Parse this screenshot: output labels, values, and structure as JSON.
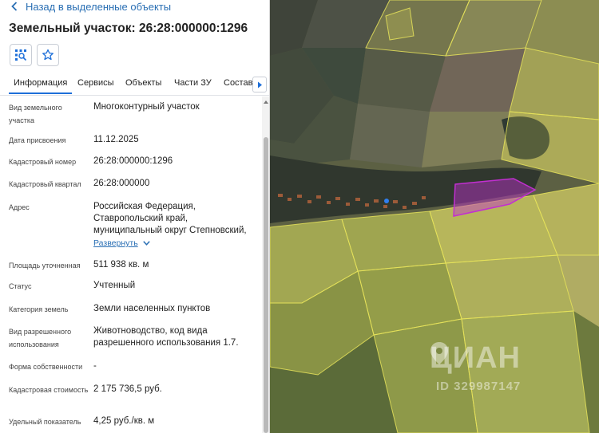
{
  "header": {
    "back_label": "Назад в выделенные объекты",
    "title": "Земельный участок: 26:28:000000:1296"
  },
  "toolbar": {
    "locate_icon": "locate-on-map-icon",
    "favorite_icon": "star-icon"
  },
  "tabs": [
    {
      "label": "Информация",
      "active": true
    },
    {
      "label": "Сервисы",
      "active": false
    },
    {
      "label": "Объекты",
      "active": false
    },
    {
      "label": "Части ЗУ",
      "active": false
    },
    {
      "label": "Состав",
      "active": false
    }
  ],
  "properties": [
    {
      "label": "Вид земельного участка",
      "value": "Многоконтурный участок"
    },
    {
      "label": "Дата присвоения",
      "value": "11.12.2025"
    },
    {
      "label": "Кадастровый номер",
      "value": "26:28:000000:1296"
    },
    {
      "label": "Кадастровый квартал",
      "value": "26:28:000000"
    },
    {
      "label": "Адрес",
      "value": "Российская Федерация, Ставропольский край, муниципальный округ Степновский,"
    },
    {
      "label": "Площадь уточненная",
      "value": "511 938 кв. м"
    },
    {
      "label": "Статус",
      "value": "Учтенный"
    },
    {
      "label": "Категория земель",
      "value": "Земли населенных пунктов"
    },
    {
      "label": "Вид разрешенного использования",
      "value": "Животноводство, код вида разрешенного использования 1.7."
    },
    {
      "label": "Форма собственности",
      "value": "-"
    },
    {
      "label": "Кадастровая стоимость",
      "value": "2 175 736,5 руб."
    },
    {
      "label": "Удельный показатель",
      "value": "4,25 руб./кв. м"
    }
  ],
  "expand_label": "Развернуть",
  "map": {
    "watermark_brand": "ЦИАН",
    "watermark_id": "ID 329987147",
    "highlight_color": "#c22fd1",
    "parcel_color": "#e6e35a"
  }
}
